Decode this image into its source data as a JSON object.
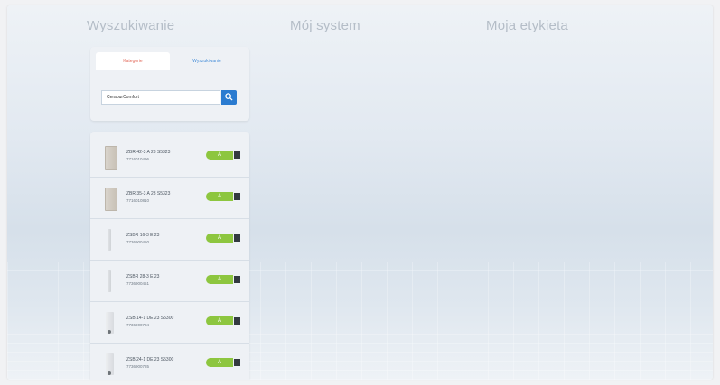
{
  "nav": {
    "items": [
      "Wyszukiwanie",
      "Mój system",
      "Moja etykieta"
    ]
  },
  "search": {
    "tabs": [
      "Kategorie",
      "Wyszukiwanie"
    ],
    "value": "CerapurComfort",
    "button_icon": "search-icon"
  },
  "results": [
    {
      "model": "ZBR 42-3 A 23 S5323",
      "sku": "7716010496",
      "label": "A",
      "thumb": "panel"
    },
    {
      "model": "ZBR 35-3 A 23 S5323",
      "sku": "7716010810",
      "label": "A",
      "thumb": "panel"
    },
    {
      "model": "ZSBR 16-3 E 23",
      "sku": "7736900450",
      "label": "A",
      "thumb": "slim"
    },
    {
      "model": "ZSBR 28-3 E 23",
      "sku": "7736900451",
      "label": "A",
      "thumb": "slim"
    },
    {
      "model": "ZSB 14-1 DE 23 S5300",
      "sku": "7736900784",
      "label": "A",
      "thumb": "ext"
    },
    {
      "model": "ZSB 24-1 DE 23 S5300",
      "sku": "7736900785",
      "label": "A",
      "thumb": "ext"
    }
  ],
  "colors": {
    "label_green": "#8dc63f",
    "accent_blue": "#2a7bd0",
    "active_tab_text": "#e26a5b"
  }
}
